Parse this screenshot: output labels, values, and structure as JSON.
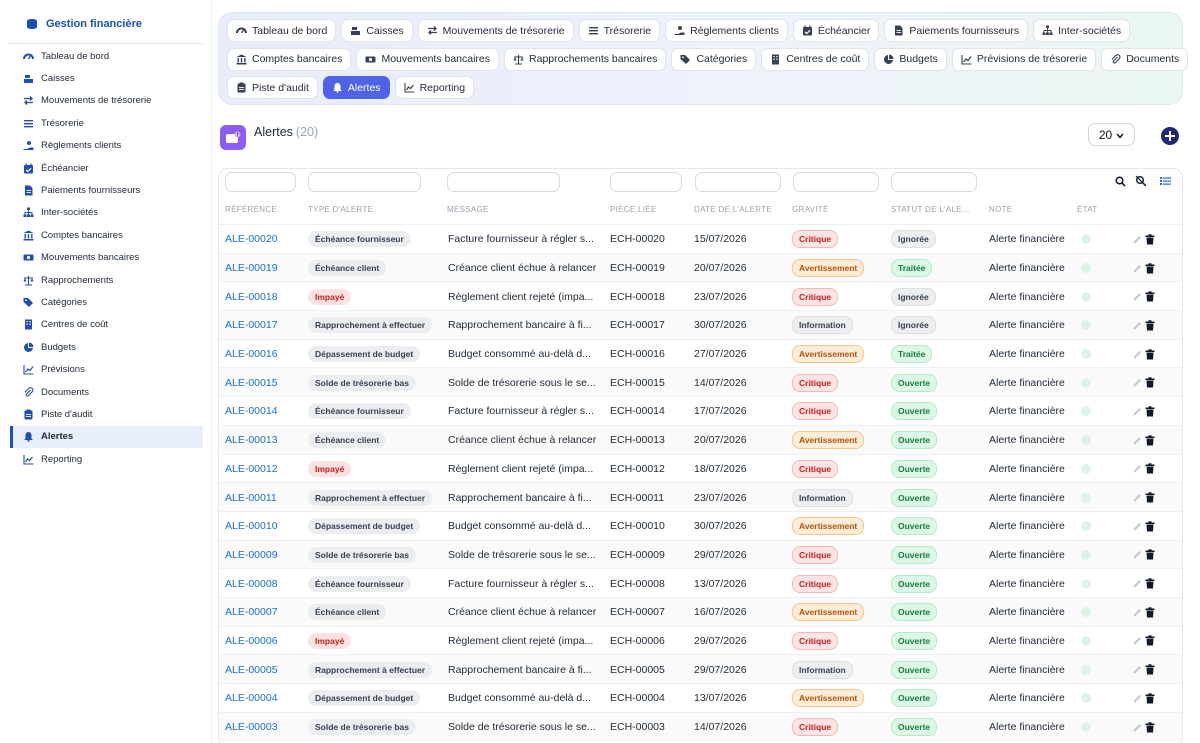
{
  "sidebar": {
    "brand": "Gestion financière",
    "items": [
      {
        "label": "Tableau de bord",
        "icon": "dashboard-icon"
      },
      {
        "label": "Caisses",
        "icon": "cash-register-icon"
      },
      {
        "label": "Mouvements de trésorerie",
        "icon": "transfer-arrows-icon"
      },
      {
        "label": "Trésorerie",
        "icon": "list-icon"
      },
      {
        "label": "Règlements clients",
        "icon": "hand-money-icon"
      },
      {
        "label": "Échéancier",
        "icon": "calendar-check-icon"
      },
      {
        "label": "Paiements fournisseurs",
        "icon": "invoice-icon"
      },
      {
        "label": "Inter-sociétés",
        "icon": "org-chart-icon"
      },
      {
        "label": "Comptes bancaires",
        "icon": "bank-icon"
      },
      {
        "label": "Mouvements bancaires",
        "icon": "money-bill-icon"
      },
      {
        "label": "Rapprochements",
        "icon": "scale-icon"
      },
      {
        "label": "Catégories",
        "icon": "tags-icon"
      },
      {
        "label": "Centres de coût",
        "icon": "building-icon"
      },
      {
        "label": "Budgets",
        "icon": "pie-chart-icon"
      },
      {
        "label": "Prévisions",
        "icon": "line-chart-icon"
      },
      {
        "label": "Documents",
        "icon": "paperclip-icon"
      },
      {
        "label": "Piste d'audit",
        "icon": "clipboard-icon"
      },
      {
        "label": "Alertes",
        "icon": "bell-icon"
      },
      {
        "label": "Reporting",
        "icon": "chart-icon"
      }
    ],
    "active_index": 17
  },
  "tabs": {
    "rows": [
      [
        {
          "label": "Tableau de bord",
          "icon": "dashboard-icon"
        },
        {
          "label": "Caisses",
          "icon": "cash-register-icon"
        },
        {
          "label": "Mouvements de trésorerie",
          "icon": "transfer-arrows-icon"
        },
        {
          "label": "Trésorerie",
          "icon": "list-icon"
        },
        {
          "label": "Règlements clients",
          "icon": "hand-money-icon"
        },
        {
          "label": "Échéancier",
          "icon": "calendar-check-icon"
        },
        {
          "label": "Paiements fournisseurs",
          "icon": "invoice-icon"
        },
        {
          "label": "Inter-sociétés",
          "icon": "org-chart-icon"
        }
      ],
      [
        {
          "label": "Comptes bancaires",
          "icon": "bank-icon"
        },
        {
          "label": "Mouvements bancaires",
          "icon": "money-bill-icon"
        },
        {
          "label": "Rapprochements bancaires",
          "icon": "scale-icon"
        },
        {
          "label": "Catégories",
          "icon": "tags-icon"
        },
        {
          "label": "Centres de coût",
          "icon": "building-icon"
        },
        {
          "label": "Budgets",
          "icon": "pie-chart-icon"
        },
        {
          "label": "Prévisions de trésorerie",
          "icon": "line-chart-icon"
        },
        {
          "label": "Documents",
          "icon": "paperclip-icon"
        }
      ],
      [
        {
          "label": "Piste d'audit",
          "icon": "clipboard-icon"
        },
        {
          "label": "Alertes",
          "icon": "bell-icon",
          "active": true
        },
        {
          "label": "Reporting",
          "icon": "chart-icon"
        }
      ]
    ]
  },
  "header": {
    "title": "Alertes",
    "count": "(20)",
    "page_size": "20"
  },
  "table": {
    "columns": [
      "RÉFÉRENCE",
      "TYPE D'ALERTE",
      "MESSAGE",
      "PIÈCE LIÉE",
      "DATE DE L'ALERTE",
      "GRAVITÉ",
      "STATUT DE L'ALE...",
      "NOTE",
      "ÉTAT"
    ],
    "rows": [
      {
        "ref": "ALE-00020",
        "type": "Échéance fournisseur",
        "type_style": "gray",
        "message": "Facture fournisseur à régler s...",
        "piece": "ECH-00020",
        "date": "15/07/2026",
        "gravite": "Critique",
        "statut": "Ignorée",
        "note": "Alerte financière"
      },
      {
        "ref": "ALE-00019",
        "type": "Échéance client",
        "type_style": "gray",
        "message": "Créance client échue à relancer",
        "piece": "ECH-00019",
        "date": "20/07/2026",
        "gravite": "Avertissement",
        "statut": "Traitée",
        "note": "Alerte financière"
      },
      {
        "ref": "ALE-00018",
        "type": "Impayé",
        "type_style": "red",
        "message": "Règlement client rejeté (impa...",
        "piece": "ECH-00018",
        "date": "23/07/2026",
        "gravite": "Critique",
        "statut": "Ignorée",
        "note": "Alerte financière"
      },
      {
        "ref": "ALE-00017",
        "type": "Rapprochement à effectuer",
        "type_style": "gray",
        "message": "Rapprochement bancaire à fi...",
        "piece": "ECH-00017",
        "date": "30/07/2026",
        "gravite": "Information",
        "statut": "Ignorée",
        "note": "Alerte financière"
      },
      {
        "ref": "ALE-00016",
        "type": "Dépassement de budget",
        "type_style": "gray",
        "message": "Budget consommé au-delà d...",
        "piece": "ECH-00016",
        "date": "27/07/2026",
        "gravite": "Avertissement",
        "statut": "Traitée",
        "note": "Alerte financière"
      },
      {
        "ref": "ALE-00015",
        "type": "Solde de trésorerie bas",
        "type_style": "gray",
        "message": "Solde de trésorerie sous le se...",
        "piece": "ECH-00015",
        "date": "14/07/2026",
        "gravite": "Critique",
        "statut": "Ouverte",
        "note": "Alerte financière"
      },
      {
        "ref": "ALE-00014",
        "type": "Échéance fournisseur",
        "type_style": "gray",
        "message": "Facture fournisseur à régler s...",
        "piece": "ECH-00014",
        "date": "17/07/2026",
        "gravite": "Critique",
        "statut": "Ouverte",
        "note": "Alerte financière"
      },
      {
        "ref": "ALE-00013",
        "type": "Échéance client",
        "type_style": "gray",
        "message": "Créance client échue à relancer",
        "piece": "ECH-00013",
        "date": "20/07/2026",
        "gravite": "Avertissement",
        "statut": "Ouverte",
        "note": "Alerte financière"
      },
      {
        "ref": "ALE-00012",
        "type": "Impayé",
        "type_style": "red",
        "message": "Règlement client rejeté (impa...",
        "piece": "ECH-00012",
        "date": "18/07/2026",
        "gravite": "Critique",
        "statut": "Ouverte",
        "note": "Alerte financière"
      },
      {
        "ref": "ALE-00011",
        "type": "Rapprochement à effectuer",
        "type_style": "gray",
        "message": "Rapprochement bancaire à fi...",
        "piece": "ECH-00011",
        "date": "23/07/2026",
        "gravite": "Information",
        "statut": "Ouverte",
        "note": "Alerte financière"
      },
      {
        "ref": "ALE-00010",
        "type": "Dépassement de budget",
        "type_style": "gray",
        "message": "Budget consommé au-delà d...",
        "piece": "ECH-00010",
        "date": "30/07/2026",
        "gravite": "Avertissement",
        "statut": "Ouverte",
        "note": "Alerte financière"
      },
      {
        "ref": "ALE-00009",
        "type": "Solde de trésorerie bas",
        "type_style": "gray",
        "message": "Solde de trésorerie sous le se...",
        "piece": "ECH-00009",
        "date": "29/07/2026",
        "gravite": "Critique",
        "statut": "Ouverte",
        "note": "Alerte financière"
      },
      {
        "ref": "ALE-00008",
        "type": "Échéance fournisseur",
        "type_style": "gray",
        "message": "Facture fournisseur à régler s...",
        "piece": "ECH-00008",
        "date": "13/07/2026",
        "gravite": "Critique",
        "statut": "Ouverte",
        "note": "Alerte financière"
      },
      {
        "ref": "ALE-00007",
        "type": "Échéance client",
        "type_style": "gray",
        "message": "Créance client échue à relancer",
        "piece": "ECH-00007",
        "date": "16/07/2026",
        "gravite": "Avertissement",
        "statut": "Ouverte",
        "note": "Alerte financière"
      },
      {
        "ref": "ALE-00006",
        "type": "Impayé",
        "type_style": "red",
        "message": "Règlement client rejeté (impa...",
        "piece": "ECH-00006",
        "date": "29/07/2026",
        "gravite": "Critique",
        "statut": "Ouverte",
        "note": "Alerte financière"
      },
      {
        "ref": "ALE-00005",
        "type": "Rapprochement à effectuer",
        "type_style": "gray",
        "message": "Rapprochement bancaire à fi...",
        "piece": "ECH-00005",
        "date": "29/07/2026",
        "gravite": "Information",
        "statut": "Ouverte",
        "note": "Alerte financière"
      },
      {
        "ref": "ALE-00004",
        "type": "Dépassement de budget",
        "type_style": "gray",
        "message": "Budget consommé au-delà d...",
        "piece": "ECH-00004",
        "date": "13/07/2026",
        "gravite": "Avertissement",
        "statut": "Ouverte",
        "note": "Alerte financière"
      },
      {
        "ref": "ALE-00003",
        "type": "Solde de trésorerie bas",
        "type_style": "gray",
        "message": "Solde de trésorerie sous le se...",
        "piece": "ECH-00003",
        "date": "14/07/2026",
        "gravite": "Critique",
        "statut": "Ouverte",
        "note": "Alerte financière"
      }
    ]
  },
  "colors": {
    "brand": "#1d4fb8",
    "active_tab": "#4f63e6",
    "link": "#1a6fd4",
    "title_icon": "#8b5cf6"
  }
}
